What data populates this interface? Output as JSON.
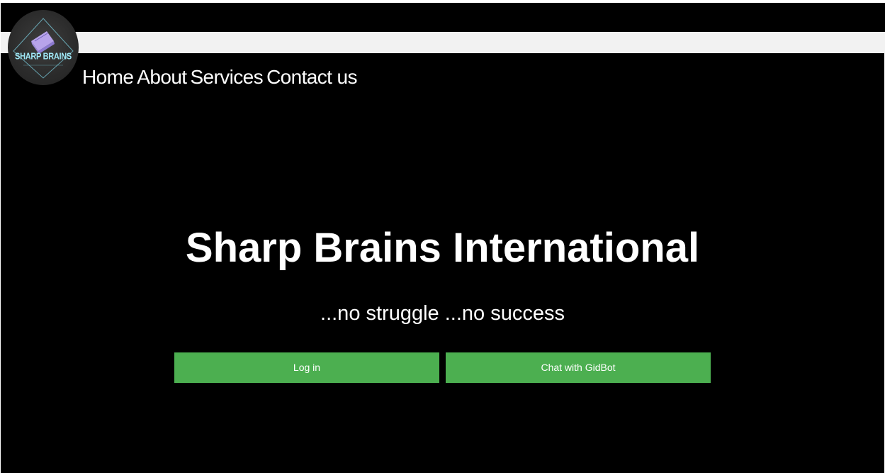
{
  "brand": {
    "logo_text": "SHARP BRAINS",
    "logo_icon": "book-icon",
    "accent_color": "#9fe7f5"
  },
  "nav": {
    "items": [
      {
        "label": "Home"
      },
      {
        "label": "About"
      },
      {
        "label": "Services"
      },
      {
        "label": "Contact us"
      }
    ]
  },
  "hero": {
    "title": "Sharp Brains International",
    "tagline": "...no struggle ...no success"
  },
  "actions": {
    "login_label": "Log in",
    "chat_label": "Chat with GidBot",
    "button_color": "#4caf50"
  }
}
